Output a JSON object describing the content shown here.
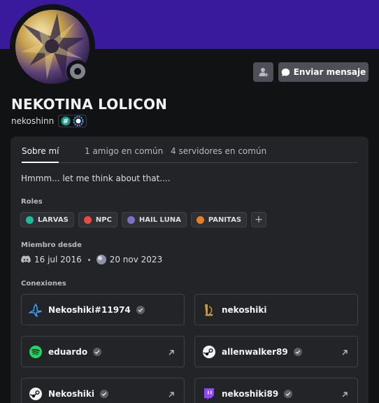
{
  "colors": {
    "banner": "#3a1a9c",
    "background": "#111214",
    "card": "#232428",
    "button": "#4e5058"
  },
  "profile": {
    "display_name": "NEKOTINA LOLICON",
    "username": "nekoshinn",
    "status": "offline"
  },
  "actions": {
    "message_label": "Enviar mensaje"
  },
  "tabs": [
    {
      "label": "Sobre mí",
      "active": true
    },
    {
      "label": "1 amigo en común",
      "active": false
    },
    {
      "label": "4 servidores en común",
      "active": false
    }
  ],
  "about": "Hmmm... let me think about that....",
  "roles": {
    "title": "Roles",
    "items": [
      {
        "name": "LARVAS",
        "color": "#1abc9c"
      },
      {
        "name": "NPC",
        "color": "#e74c3c"
      },
      {
        "name": "HAIL LUNA",
        "color": "#7b72c7"
      },
      {
        "name": "PANITAS",
        "color": "#e67e22"
      }
    ],
    "add_label": "+"
  },
  "member_since": {
    "title": "Miembro desde",
    "discord_date": "16 jul 2016",
    "server_date": "20 nov 2023"
  },
  "connections": {
    "title": "Conexiones",
    "items": [
      {
        "service": "battlenet-icon",
        "name": "Nekoshiki#11974",
        "verified": true,
        "external": false
      },
      {
        "service": "league-icon",
        "name": "nekoshiki",
        "verified": false,
        "external": false
      },
      {
        "service": "spotify-icon",
        "name": "eduardo",
        "verified": true,
        "external": true
      },
      {
        "service": "steam-icon",
        "name": "allenwalker89",
        "verified": true,
        "external": true
      },
      {
        "service": "steam-icon",
        "name": "Nekoshiki",
        "verified": true,
        "external": true
      },
      {
        "service": "twitch-icon",
        "name": "nekoshiki89",
        "verified": true,
        "external": true
      }
    ]
  }
}
